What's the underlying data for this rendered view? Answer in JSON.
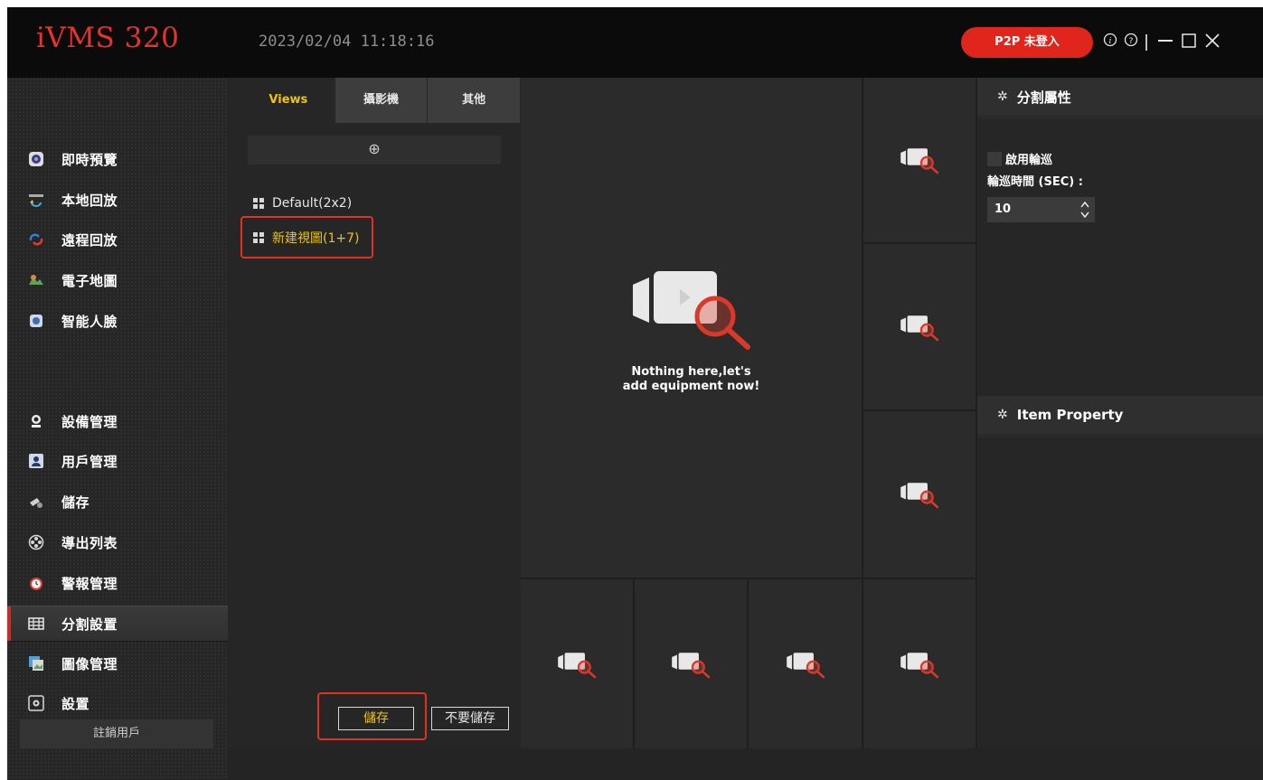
{
  "app": {
    "logo": "iVMS 320",
    "datetime": "2023/02/04 11:18:16",
    "p2p_label": "P2P 未登入"
  },
  "window_controls": {
    "info_icon": "info-icon",
    "help_icon": "help-icon",
    "minimize_icon": "minimize-icon",
    "maximize_icon": "maximize-icon",
    "close_icon": "close-icon"
  },
  "sidebar": {
    "items": [
      {
        "label": "即時預覽",
        "icon": "live-view-icon"
      },
      {
        "label": "本地回放",
        "icon": "local-playback-icon"
      },
      {
        "label": "遠程回放",
        "icon": "remote-playback-icon"
      },
      {
        "label": "電子地圖",
        "icon": "emap-icon"
      },
      {
        "label": "智能人臉",
        "icon": "face-recognition-icon"
      },
      {
        "label": "設備管理",
        "icon": "device-management-icon"
      },
      {
        "label": "用戶管理",
        "icon": "user-management-icon"
      },
      {
        "label": "儲存",
        "icon": "storage-icon"
      },
      {
        "label": "導出列表",
        "icon": "export-list-icon"
      },
      {
        "label": "警報管理",
        "icon": "alarm-icon"
      },
      {
        "label": "分割設置",
        "icon": "split-settings-icon"
      },
      {
        "label": "圖像管理",
        "icon": "image-management-icon"
      },
      {
        "label": "設置",
        "icon": "settings-icon"
      }
    ],
    "active_item": "分割設置",
    "logout_label": "註銷用戶"
  },
  "views_panel": {
    "tabs": [
      "Views",
      "攝影機",
      "其他"
    ],
    "active_tab": "Views",
    "add_symbol": "⊕",
    "views": [
      {
        "label": "Default(2x2)"
      },
      {
        "label": "新建視圖(1+7)"
      }
    ],
    "selected_view": "新建視圖(1+7)",
    "save_label": "儲存",
    "discard_label": "不要儲存",
    "bottom_tool_icons": [
      "window-icon",
      "sort-icon"
    ]
  },
  "video_grid": {
    "empty_message_line1": "Nothing here,let's",
    "empty_message_line2": "add equipment now!",
    "cell_icon": "camera-search-icon"
  },
  "right_panel": {
    "split_props_title": "分割屬性",
    "enable_tour_label": "啟用輪巡",
    "enable_tour_checked": false,
    "tour_time_label": "輪巡時間 (SEC) :",
    "tour_time_value": "10",
    "item_property_title": "Item Property"
  },
  "colors": {
    "accent_red": "#e0261c",
    "active_yellow": "#f2c400",
    "background": "#2a2a2a"
  }
}
